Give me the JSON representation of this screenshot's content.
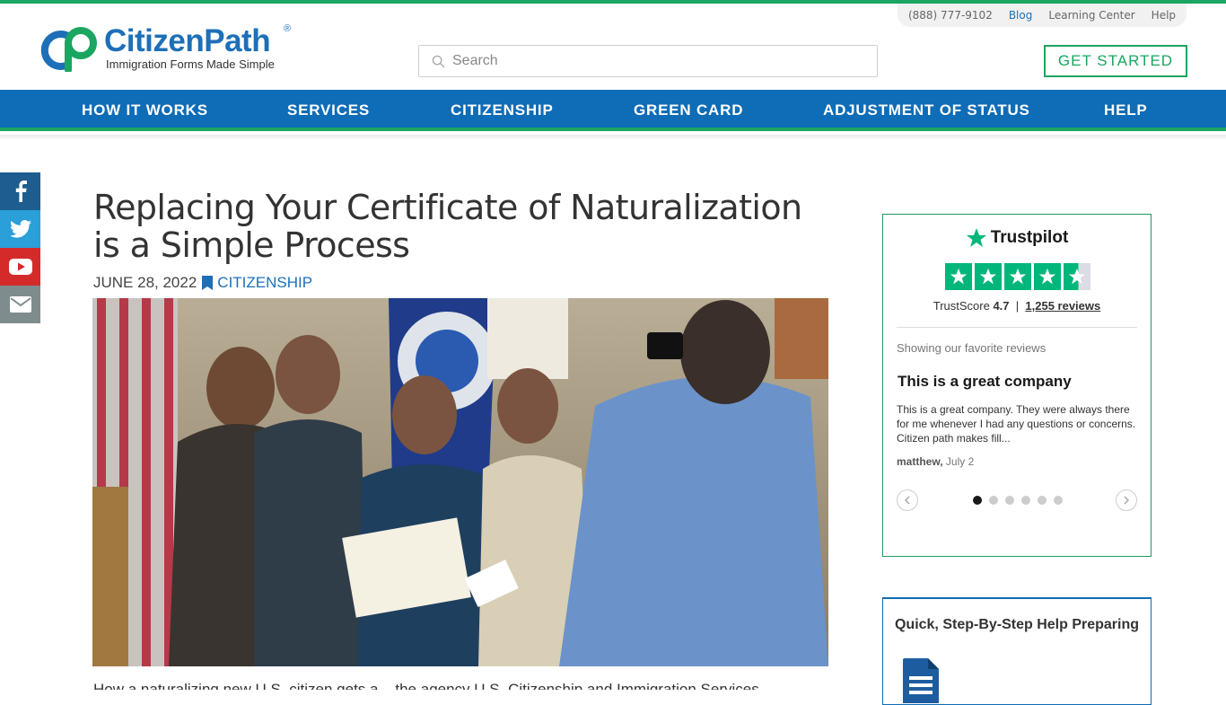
{
  "utility": {
    "phone": "(888) 777-9102",
    "blog": "Blog",
    "learning": "Learning Center",
    "help": "Help"
  },
  "logo": {
    "word": "CitizenPath",
    "reg": "®",
    "tagline": "Immigration Forms Made Simple"
  },
  "search": {
    "placeholder": "Search"
  },
  "cta": {
    "label": "GET STARTED"
  },
  "nav": {
    "items": [
      "HOW IT WORKS",
      "SERVICES",
      "CITIZENSHIP",
      "GREEN CARD",
      "ADJUSTMENT OF STATUS",
      "HELP"
    ]
  },
  "social": [
    "facebook-icon",
    "twitter-icon",
    "youtube-icon",
    "email-icon"
  ],
  "article": {
    "title": "Replacing Your Certificate of Naturalization is a Simple Process",
    "date": "JUNE 28, 2022",
    "category": "CITIZENSHIP",
    "body_start": "How a naturalizing new U.S. citizen gets a... the agency U.S. Citizenship and Immigration Services"
  },
  "trustpilot": {
    "brand": "Trustpilot",
    "score_label": "TrustScore",
    "score": "4.7",
    "separator": "|",
    "reviews": "1,255 reviews",
    "rating": 4.7,
    "showing": "Showing our favorite reviews",
    "review_title": "This is a great company",
    "review_body": "This is a great company. They were always there for me whenever I had any questions or concerns. Citizen path makes fill...",
    "review_author": "matthew,",
    "review_date": "July 2",
    "dots": 6,
    "active_dot": 0
  },
  "colors": {
    "green": "#1aa660",
    "blue": "#0f6cb6",
    "trustpilot_green": "#00b67a"
  },
  "help_card": {
    "heading": "Quick, Step-By-Step Help Preparing"
  }
}
